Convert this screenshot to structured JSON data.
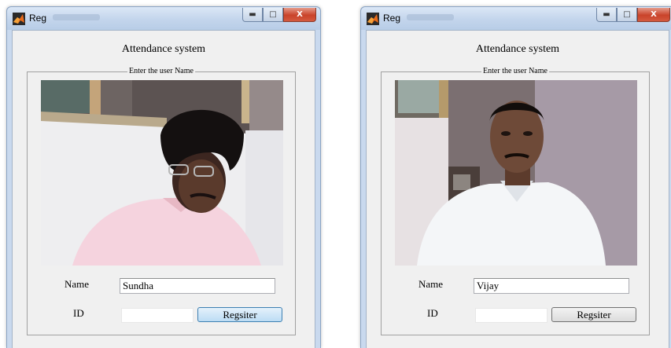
{
  "windows": [
    {
      "title": "Reg",
      "heading": "Attendance system",
      "panel_legend": "Enter the user Name",
      "name_label": "Name",
      "name_value": "Sundha",
      "id_label": "ID",
      "id_value": "",
      "register_label": "Regsiter",
      "register_state": "hover"
    },
    {
      "title": "Reg",
      "heading": "Attendance system",
      "panel_legend": "Enter the user Name",
      "name_label": "Name",
      "name_value": "Vijay",
      "id_label": "ID",
      "id_value": "",
      "register_label": "Regsiter",
      "register_state": "normal"
    }
  ],
  "window_controls": {
    "minimize": "minimize",
    "maximize": "maximize",
    "close": "close"
  },
  "icons": [
    "matlab-icon",
    "minimize-icon",
    "maximize-icon",
    "close-icon"
  ],
  "colors": {
    "titlebar": "#c3d5ec",
    "close_button": "#c9432a",
    "client_bg": "#f0f0f0"
  }
}
